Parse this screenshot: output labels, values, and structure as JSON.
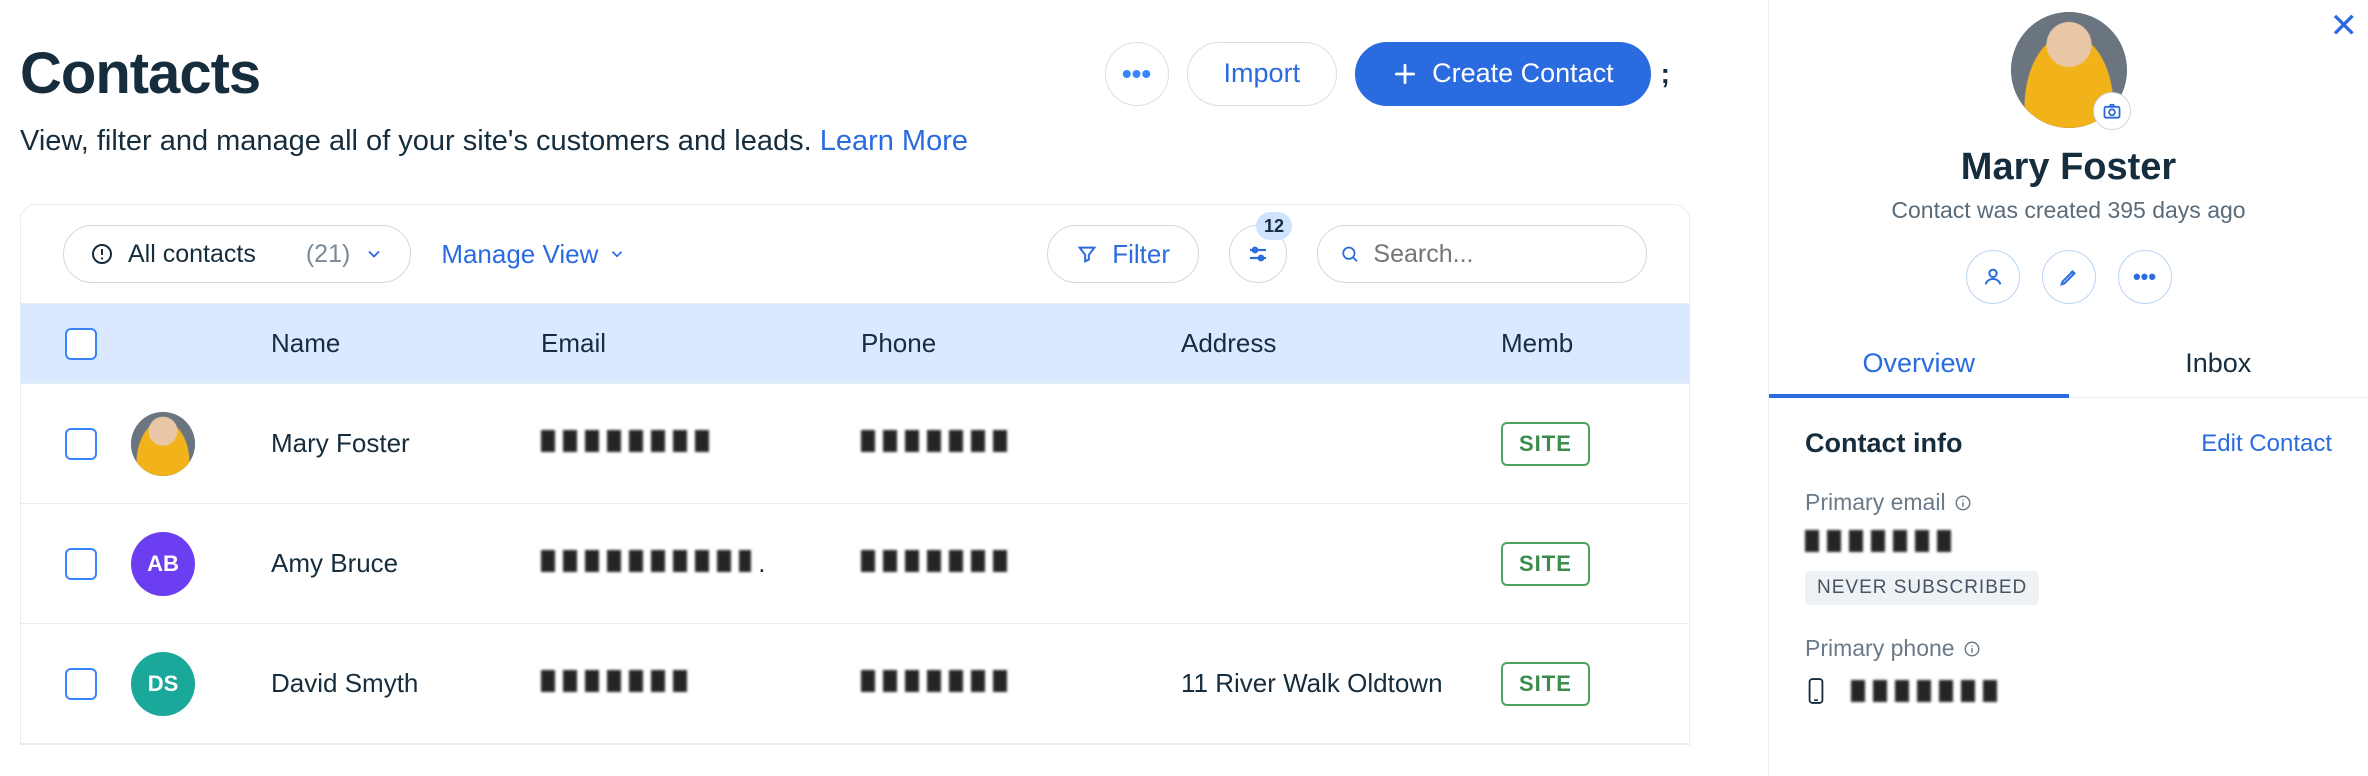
{
  "header": {
    "title": "Contacts",
    "subtitle_prefix": "View, filter and manage all of your site's customers and leads. ",
    "learn_more": "Learn More",
    "more_button": "•••",
    "import_label": "Import",
    "create_label": "Create Contact",
    "trailing_char": ";"
  },
  "toolbar": {
    "view_pill_label": "All contacts",
    "view_pill_count": "(21)",
    "manage_view_label": "Manage View",
    "filter_label": "Filter",
    "adjust_badge": "12",
    "search_placeholder": "Search..."
  },
  "table": {
    "columns": {
      "name": "Name",
      "email": "Email",
      "phone": "Phone",
      "address": "Address",
      "member": "Memb"
    },
    "rows": [
      {
        "name": "Mary Foster",
        "avatar": {
          "type": "photo"
        },
        "address": "",
        "badge": "SITE"
      },
      {
        "name": "Amy Bruce",
        "avatar": {
          "type": "initials",
          "text": "AB",
          "class": "initials-ab"
        },
        "address": "",
        "badge": "SITE"
      },
      {
        "name": "David Smyth",
        "avatar": {
          "type": "initials",
          "text": "DS",
          "class": "initials-ds"
        },
        "address": "11 River Walk Oldtown",
        "badge": "SITE"
      }
    ]
  },
  "panel": {
    "name": "Mary Foster",
    "subtext": "Contact was created 395 days ago",
    "tabs": {
      "overview": "Overview",
      "inbox": "Inbox"
    },
    "section_title": "Contact info",
    "edit_label": "Edit Contact",
    "primary_email_label": "Primary email",
    "never_subscribed": "NEVER SUBSCRIBED",
    "primary_phone_label": "Primary phone"
  }
}
